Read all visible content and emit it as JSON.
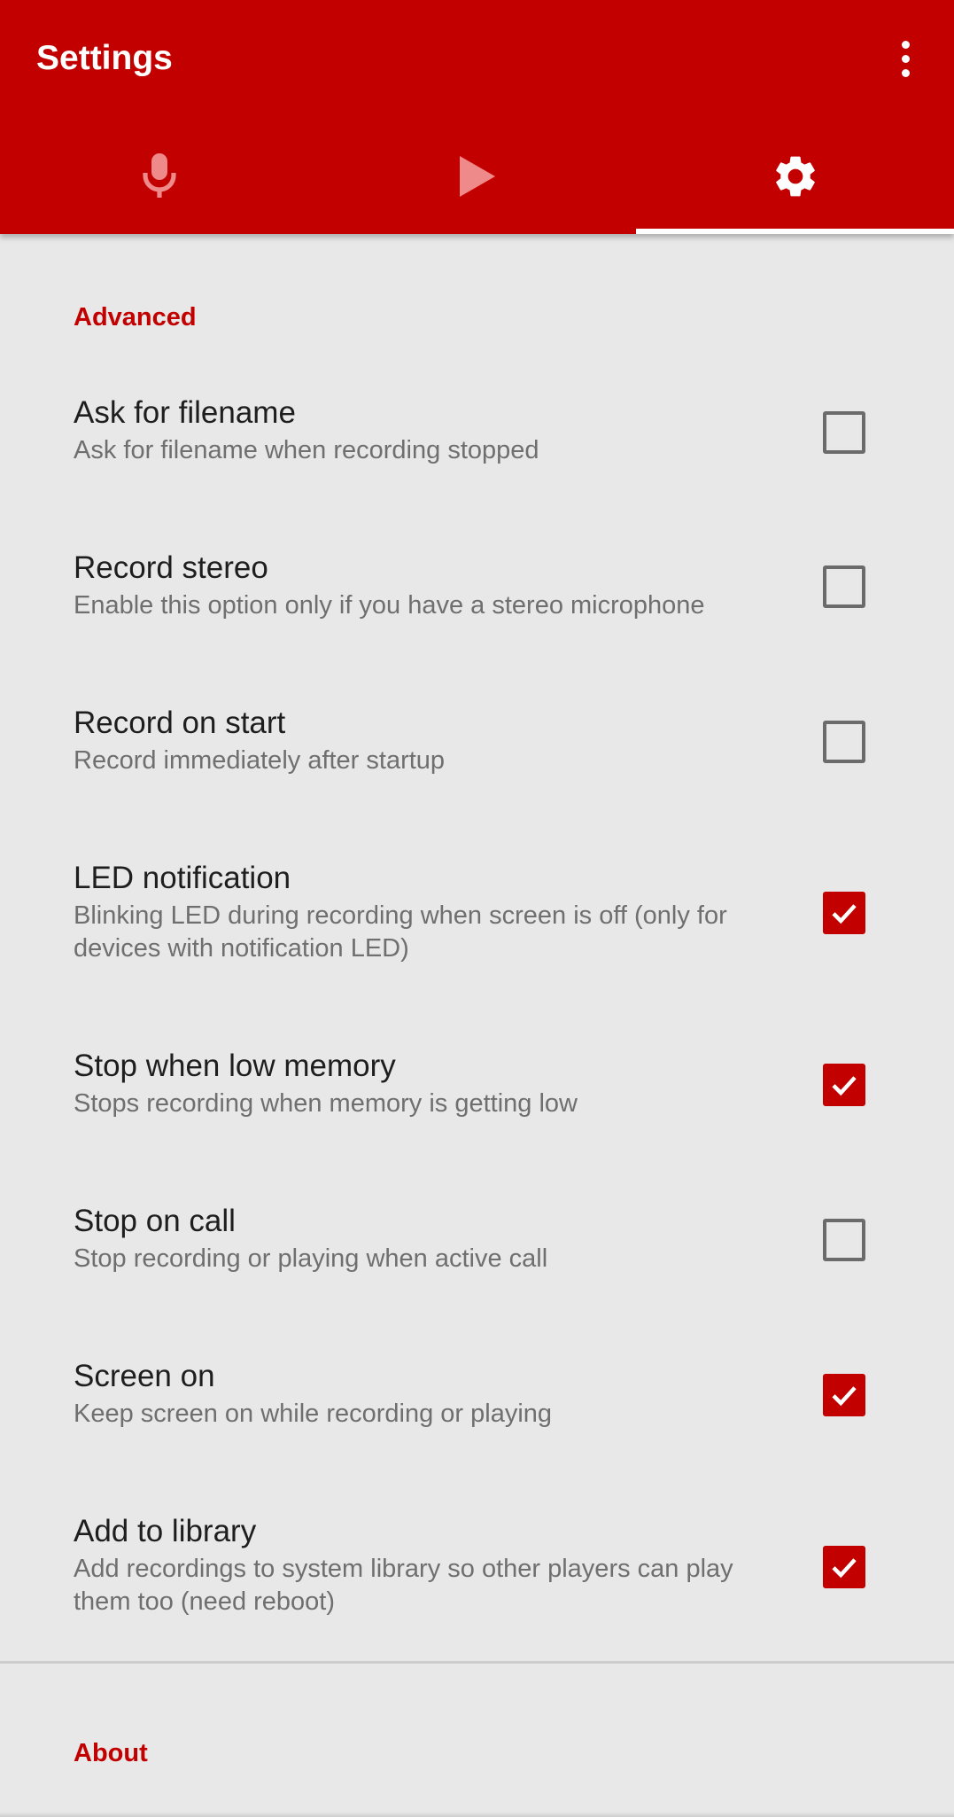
{
  "appbar": {
    "title": "Settings",
    "background": "#c20000",
    "overflow_icon": "more-vert-icon"
  },
  "tabs": [
    {
      "name": "record",
      "icon": "microphone-icon",
      "selected": false
    },
    {
      "name": "play",
      "icon": "play-icon",
      "selected": false
    },
    {
      "name": "settings",
      "icon": "gear-icon",
      "selected": true
    }
  ],
  "sections": {
    "advanced": "Advanced",
    "about": "About"
  },
  "prefs": [
    {
      "title": "Ask for filename",
      "summary": "Ask for filename when recording stopped",
      "checked": false
    },
    {
      "title": "Record stereo",
      "summary": "Enable this option only if you have a stereo microphone",
      "checked": false
    },
    {
      "title": "Record on start",
      "summary": "Record immediately after startup",
      "checked": false
    },
    {
      "title": "LED notification",
      "summary": "Blinking LED during recording when screen is off (only for devices with notification LED)",
      "checked": true
    },
    {
      "title": "Stop when low memory",
      "summary": "Stops recording when memory is getting low",
      "checked": true
    },
    {
      "title": "Stop on call",
      "summary": "Stop recording or playing when active call",
      "checked": false
    },
    {
      "title": "Screen on",
      "summary": "Keep screen on while recording or playing",
      "checked": true
    },
    {
      "title": "Add to library",
      "summary": "Add recordings to system library so other players can play them too (need reboot)",
      "checked": true
    }
  ],
  "colors": {
    "accent": "#c20000",
    "background": "#e8e8e8",
    "checkbox_unchecked": "#6b6b6b"
  }
}
